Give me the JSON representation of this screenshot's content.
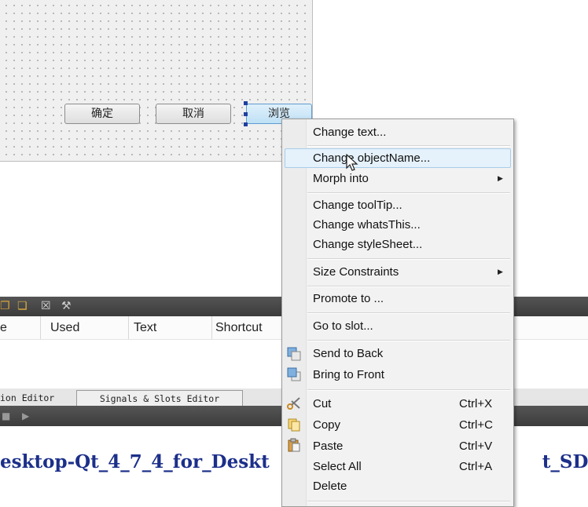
{
  "form": {
    "ok_button": "确定",
    "cancel_button": "取消",
    "browse_button": "浏览"
  },
  "action_editor": {
    "columns": [
      "e",
      "Used",
      "Text",
      "Shortcut"
    ],
    "toolbar_icons": [
      "copy-icon",
      "paste-icon",
      "delete-icon",
      "wrench-icon"
    ]
  },
  "editor_tabs": {
    "action_editor": "ion Editor",
    "signals_slots_editor": "Signals & Slots Editor"
  },
  "output": {
    "path_text": "esktop-Qt_4_7_4_for_Deskt",
    "path_text_tail": "t_SDK)"
  },
  "context_menu": {
    "change_text": "Change text...",
    "change_object_name": "Change objectName...",
    "morph_into": "Morph into",
    "change_tooltip": "Change toolTip...",
    "change_whatsthis": "Change whatsThis...",
    "change_stylesheet": "Change styleSheet...",
    "size_constraints": "Size Constraints",
    "promote_to": "Promote to ...",
    "go_to_slot": "Go to slot...",
    "send_to_back": "Send to Back",
    "bring_to_front": "Bring to Front",
    "cut": "Cut",
    "cut_shortcut": "Ctrl+X",
    "copy": "Copy",
    "copy_shortcut": "Ctrl+C",
    "paste": "Paste",
    "paste_shortcut": "Ctrl+V",
    "select_all": "Select All",
    "select_all_shortcut": "Ctrl+A",
    "delete": "Delete",
    "highlighted_item": "Change objectName..."
  },
  "colors": {
    "menu_highlight": "#e5f1fb",
    "path_text": "#1c2f8a",
    "selection_handle": "#1f3f9f"
  }
}
